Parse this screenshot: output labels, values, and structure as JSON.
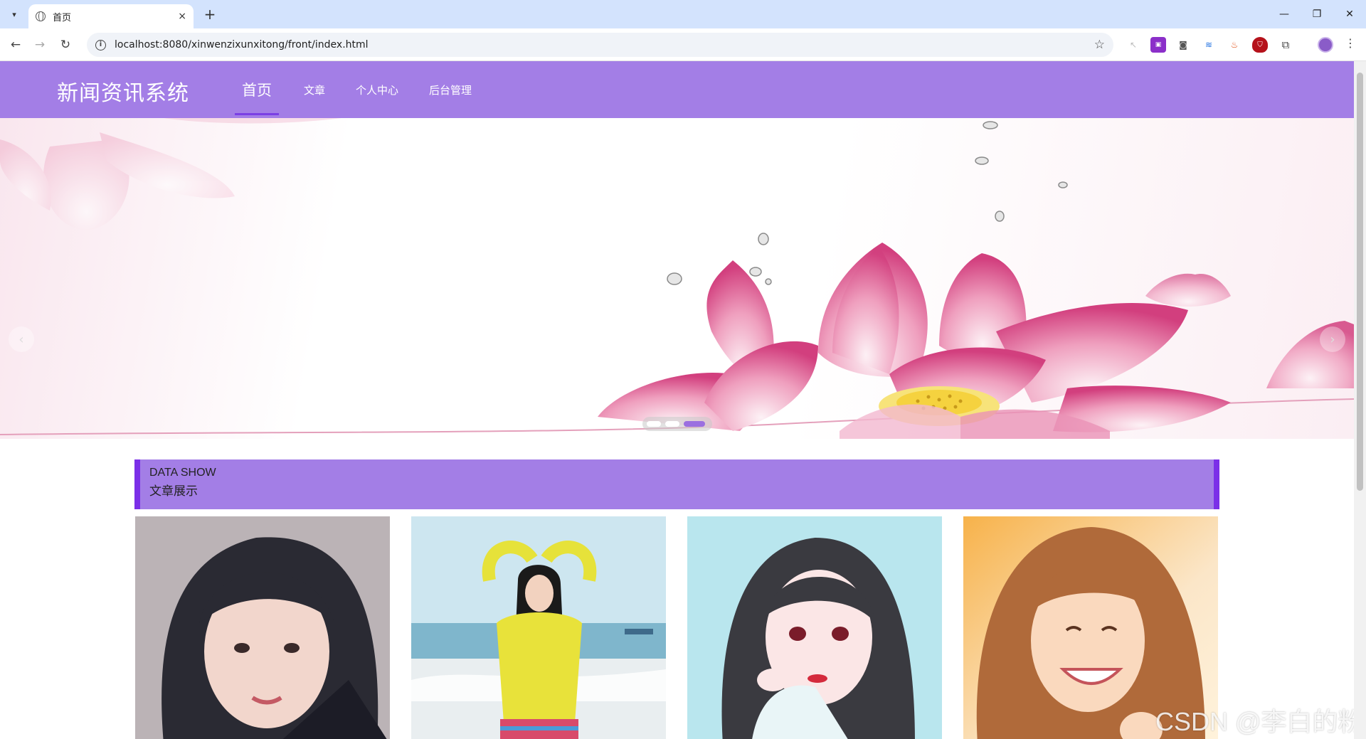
{
  "browser": {
    "tab_title": "首页",
    "tab_close": "×",
    "new_tab": "+",
    "url": "localhost:8080/xinwenzixunxitong/front/index.html",
    "window_controls": {
      "minimize": "—",
      "restore": "❐",
      "close": "✕"
    }
  },
  "header": {
    "site_title": "新闻资讯系统",
    "menu": [
      {
        "label": "首页",
        "active": true
      },
      {
        "label": "文章",
        "active": false
      },
      {
        "label": "个人中心",
        "active": false
      },
      {
        "label": "后台管理",
        "active": false
      }
    ],
    "colors": {
      "header_bg": "#a37ee6",
      "accent": "#7b2fe8"
    }
  },
  "carousel": {
    "prev_arrow": "‹",
    "next_arrow": "›",
    "slide_count": 3,
    "active_index": 2
  },
  "section": {
    "title_en": "DATA SHOW",
    "title_cn": "文章展示"
  },
  "cards": [
    {
      "image": "portrait-dark-hair"
    },
    {
      "image": "girl-yellow-sweater-beach"
    },
    {
      "image": "illustrated-girl"
    },
    {
      "image": "smiling-girl-warm-light"
    }
  ],
  "watermark": "CSDN @李白的粉"
}
